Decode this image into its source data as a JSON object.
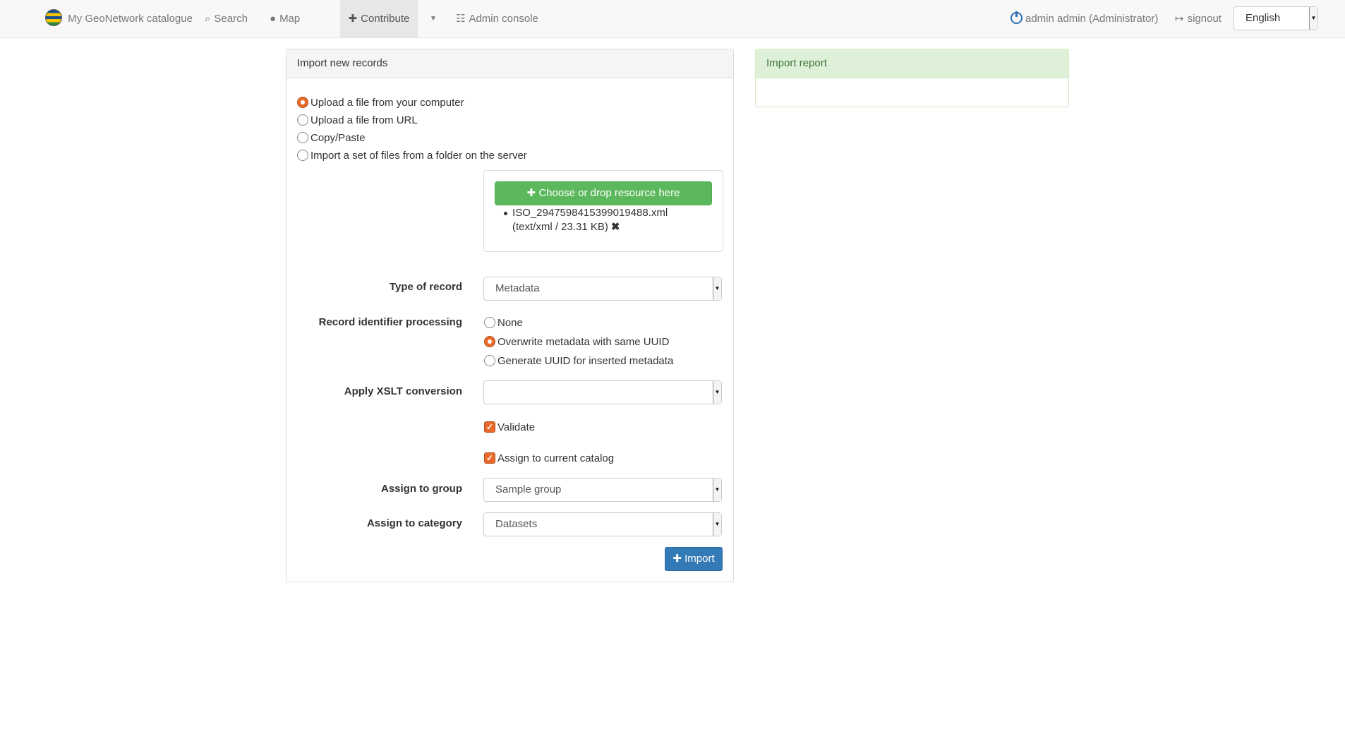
{
  "navbar": {
    "brand": "My GeoNetwork catalogue",
    "search": "Search",
    "map": "Map",
    "contribute": "Contribute",
    "admin_console": "Admin console",
    "user": "admin admin (Administrator)",
    "signout": "signout",
    "language": "English"
  },
  "import_panel": {
    "title": "Import new records",
    "sources": [
      {
        "label": "Upload a file from your computer",
        "checked": true
      },
      {
        "label": "Upload a file from URL",
        "checked": false
      },
      {
        "label": "Copy/Paste",
        "checked": false
      },
      {
        "label": "Import a set of files from a folder on the server",
        "checked": false
      }
    ],
    "drop_button": "Choose or drop resource here",
    "file": {
      "name": "ISO_2947598415399019488.xml",
      "meta": "(text/xml / 23.31 KB)"
    },
    "type_of_record": {
      "label": "Type of record",
      "value": "Metadata"
    },
    "record_identifier": {
      "label": "Record identifier processing",
      "options": [
        {
          "label": "None",
          "checked": false
        },
        {
          "label": "Overwrite metadata with same UUID",
          "checked": true
        },
        {
          "label": "Generate UUID for inserted metadata",
          "checked": false
        }
      ]
    },
    "xslt": {
      "label": "Apply XSLT conversion",
      "value": ""
    },
    "validate": {
      "label": "Validate",
      "checked": true
    },
    "assign_catalog": {
      "label": "Assign to current catalog",
      "checked": true
    },
    "group": {
      "label": "Assign to group",
      "value": "Sample group"
    },
    "category": {
      "label": "Assign to category",
      "value": "Datasets"
    },
    "import_button": "Import"
  },
  "report_panel": {
    "title": "Import report"
  },
  "colors": {
    "accent_orange": "#e96a2a",
    "green_button": "#5cb85c",
    "blue_button": "#337ab7",
    "report_header": "#dff0d8"
  }
}
